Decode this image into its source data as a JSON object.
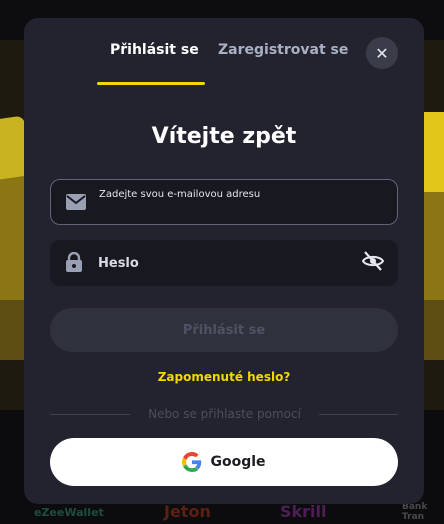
{
  "tabs": {
    "login": "Přihlásit se",
    "register": "Zaregistrovat se"
  },
  "title": "Vítejte zpět",
  "email": {
    "placeholder": "Zadejte svou e-mailovou adresu"
  },
  "password": {
    "placeholder": "Heslo"
  },
  "submit_label": "Přihlásit se",
  "forgot_label": "Zapomenuté heslo?",
  "divider_text": "Nebo se přihlaste pomocí",
  "google_label": "Google",
  "footer_logos": {
    "ezee": "eZeeWallet",
    "jeton": "Jeton",
    "skrill": "Skrill",
    "bank": "Bank Tran"
  },
  "colors": {
    "accent": "#f2d900",
    "modal_bg": "#22232f",
    "field_bg": "#171820",
    "button_disabled": "#2f313d"
  },
  "icons": [
    "close-icon",
    "envelope-icon",
    "lock-icon",
    "eye-off-icon",
    "google-icon"
  ]
}
